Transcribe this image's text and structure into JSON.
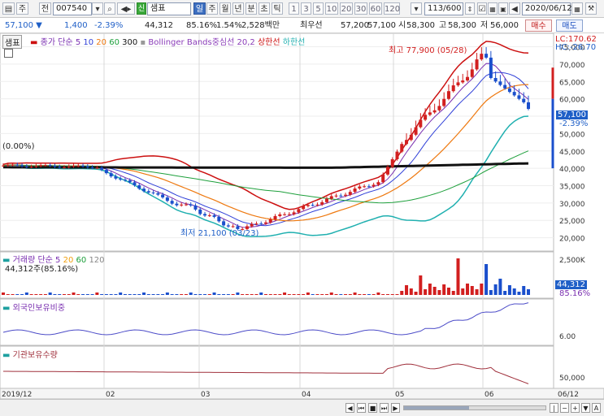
{
  "toolbar": {
    "icon1": "▤",
    "icon2": "주",
    "icon3": "전",
    "code": "007540",
    "name": "샘표",
    "period_btn_active": "일",
    "period_btns": [
      "주",
      "월",
      "년",
      "분",
      "초",
      "틱"
    ],
    "minute_btns": [
      "1",
      "3",
      "5",
      "10",
      "20",
      "30",
      "60",
      "120"
    ],
    "count": "113/600",
    "date": "2020/06/12"
  },
  "info": {
    "price": "57,100 ▼",
    "change": "1,400",
    "change_pct": "-2.39%",
    "volume": "44,312",
    "vol_ratio": "85.16%",
    "turnover": "1.54%",
    "amount": "2,528백만",
    "best_label": "최우선",
    "ask": "57,200",
    "bid": "57,100",
    "open_label": "시",
    "open": "58,300",
    "high_label": "고",
    "high": "58,300",
    "low_label": "저",
    "low": "56,000",
    "buy_btn": "매수",
    "sell_btn": "매도"
  },
  "price_panel": {
    "tab": "샘표",
    "ma_label": "종가 단순",
    "ma_periods": [
      "5",
      "10",
      "20",
      "60",
      "300"
    ],
    "bb_label": "Bollinger Bands중심선 20,2",
    "upper_label": "상한선",
    "lower_label": "하한선",
    "lc": "LC:170.62",
    "hc": "HC:-26.70",
    "left_marker": "(0.00%)",
    "high_note": "최고 77,900 (05/28)",
    "low_note": "최저 21,100 (03/23)",
    "current_price_tag": "57,100",
    "current_pct_tag": "-2.39%",
    "y_ticks": [
      "75,000",
      "70,000",
      "65,000",
      "60,000",
      "55,000",
      "50,000",
      "45,000",
      "40,000",
      "35,000",
      "30,000",
      "25,000",
      "20,000"
    ]
  },
  "volume_panel": {
    "label": "거래량",
    "ma_label": "단순",
    "ma_periods": [
      "5",
      "20",
      "60",
      "120"
    ],
    "current": "44,312주(85.16%)",
    "y_tick": "2,500K",
    "tag_value": "44,312",
    "tag_pct": "85.16%"
  },
  "foreign_panel": {
    "label": "외국인보유비중",
    "y_tick": "6.00"
  },
  "inst_panel": {
    "label": "기관보유수량",
    "y_tick": "50,000"
  },
  "x_axis": {
    "labels": [
      "2019/12",
      "02",
      "03",
      "04",
      "05",
      "06",
      "06/12"
    ]
  },
  "colors": {
    "accent_blue": "#1f5fc7",
    "up_red": "#d21f1f",
    "down_blue": "#1a4fcc",
    "ma5": "#7a2fb0",
    "ma10": "#3040d8",
    "ma20": "#f07a10",
    "ma60": "#1ea03c",
    "ma300": "#111111",
    "bb_upper": "#cc1010",
    "bb_lower": "#20b0b0",
    "bb_mid": "#a8a8a8"
  }
}
